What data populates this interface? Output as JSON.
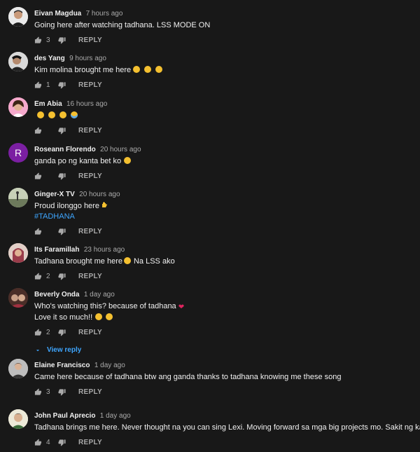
{
  "comments": [
    {
      "author": "Eivan Magdua",
      "time": "7 hours ago",
      "lines": [
        "Going here after watching tadhana. LSS MODE ON"
      ],
      "likes": "3",
      "reply_label": "REPLY"
    },
    {
      "author": "des Yang",
      "time": "9 hours ago",
      "lines": [
        "Kim molina brought me here"
      ],
      "likes": "1",
      "reply_label": "REPLY"
    },
    {
      "author": "Em Abia",
      "time": "16 hours ago",
      "lines": [
        ""
      ],
      "likes": "",
      "reply_label": "REPLY"
    },
    {
      "author": "Roseann Florendo",
      "time": "20 hours ago",
      "lines": [
        "ganda po ng kanta bet ko"
      ],
      "likes": "",
      "reply_label": "REPLY",
      "avatar_letter": "R"
    },
    {
      "author": "Ginger-X TV",
      "time": "20 hours ago",
      "lines": [
        "Proud ilonggo here",
        "#TADHANA"
      ],
      "likes": "",
      "reply_label": "REPLY"
    },
    {
      "author": "Its Faramillah",
      "time": "23 hours ago",
      "lines": [
        "Tadhana brought me here",
        "Na LSS ako"
      ],
      "likes": "2",
      "reply_label": "REPLY"
    },
    {
      "author": "Beverly Onda",
      "time": "1 day ago",
      "lines": [
        "Who's watching this? because of tadhana",
        "Love it so much!!"
      ],
      "likes": "2",
      "reply_label": "REPLY",
      "view_replies": "View reply"
    },
    {
      "author": "Elaine Francisco",
      "time": "1 day ago",
      "lines": [
        "Came here because of tadhana btw ang ganda thanks to tadhana knowing me these song"
      ],
      "likes": "3",
      "reply_label": "REPLY"
    },
    {
      "author": "John Paul Aprecio",
      "time": "1 day ago",
      "lines": [
        "Tadhana brings me here. Never thought na you can sing Lexi. Moving forward sa mga big projects mo. Sakit ng kanta :)"
      ],
      "likes": "4",
      "reply_label": "REPLY"
    }
  ],
  "colors": {
    "background": "#181818",
    "text": "#f1f1f1",
    "secondary": "#aaaaaa",
    "link": "#3ea6ff",
    "avatar_r": "#7b1fa2"
  }
}
